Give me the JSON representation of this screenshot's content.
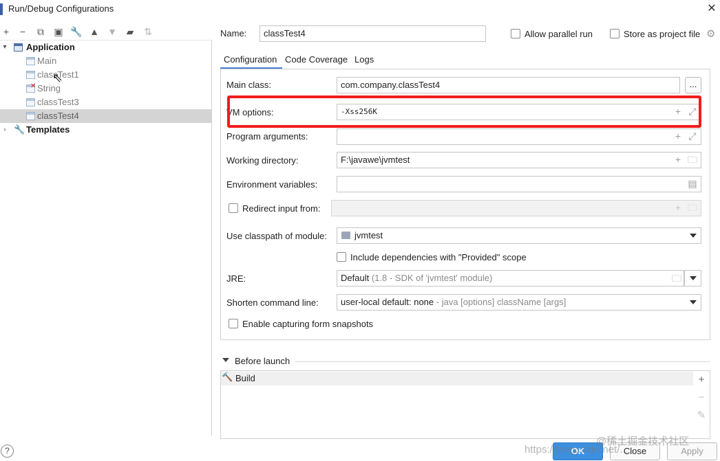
{
  "window": {
    "title": "Run/Debug Configurations"
  },
  "tree": {
    "application_label": "Application",
    "items": [
      {
        "label": "Main",
        "error": false
      },
      {
        "label": "classTest1",
        "error": false
      },
      {
        "label": "String",
        "error": true
      },
      {
        "label": "classTest3",
        "error": false
      },
      {
        "label": "classTest4",
        "error": false,
        "selected": true
      }
    ],
    "templates_label": "Templates"
  },
  "header": {
    "name_label": "Name:",
    "name_value": "classTest4",
    "allow_parallel_label": "Allow parallel run",
    "store_project_label": "Store as project file"
  },
  "tabs": [
    {
      "label": "Configuration",
      "active": true
    },
    {
      "label": "Code Coverage",
      "active": false
    },
    {
      "label": "Logs",
      "active": false
    }
  ],
  "form": {
    "main_class_label": "Main class:",
    "main_class_value": "com.company.classTest4",
    "browse_label": "...",
    "vm_options_label": "VM options:",
    "vm_options_value": "-Xss256K",
    "program_args_label": "Program arguments:",
    "program_args_value": "",
    "working_dir_label": "Working directory:",
    "working_dir_value": "F:\\javawe\\jvmtest",
    "env_vars_label": "Environment variables:",
    "env_vars_value": "",
    "redirect_label": "Redirect input from:",
    "classpath_label": "Use classpath of module:",
    "classpath_value": "jvmtest",
    "include_deps_label": "Include dependencies with \"Provided\" scope",
    "jre_label": "JRE:",
    "jre_value": "Default",
    "jre_hint": "(1.8 - SDK of 'jvmtest' module)",
    "shorten_label": "Shorten command line:",
    "shorten_value": "user-local default: none",
    "shorten_hint": "- java [options] className [args]",
    "capture_label": "Enable capturing form snapshots"
  },
  "before_launch": {
    "label": "Before launch",
    "items": [
      "Build"
    ]
  },
  "footer": {
    "ok_label": "OK",
    "close_label": "Close",
    "apply_label": "Apply",
    "help_label": "?"
  },
  "watermark": {
    "left": "https://blog.csdn.net/...",
    "right": "@稀土掘金技术社区"
  },
  "colors": {
    "highlight_box": "#f21b1b",
    "tab_accent": "#4a7fd2",
    "ok_button": "#3d8fe0",
    "selected_row": "#d4d4d4"
  }
}
